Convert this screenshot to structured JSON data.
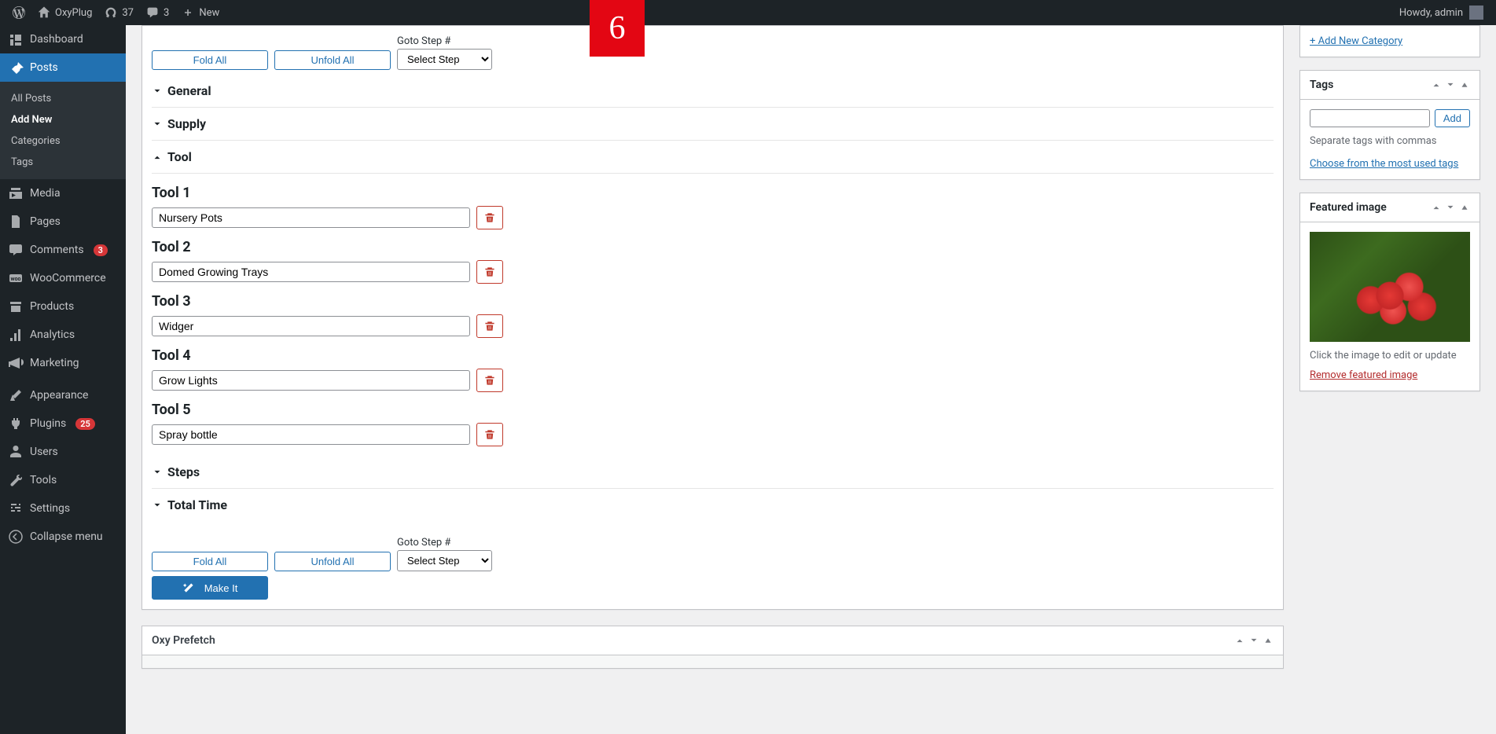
{
  "adminbar": {
    "site_name": "OxyPlug",
    "updates_count": "37",
    "comments_count": "3",
    "new_label": "New",
    "howdy": "Howdy, admin"
  },
  "badge": "6",
  "sidebar": {
    "items": [
      {
        "label": "Dashboard",
        "icon": "dashboard"
      },
      {
        "label": "Posts",
        "icon": "pin",
        "active": true
      },
      {
        "label": "Media",
        "icon": "media"
      },
      {
        "label": "Pages",
        "icon": "pages"
      },
      {
        "label": "Comments",
        "icon": "comments",
        "badge": "3"
      },
      {
        "label": "WooCommerce",
        "icon": "woo"
      },
      {
        "label": "Products",
        "icon": "products"
      },
      {
        "label": "Analytics",
        "icon": "analytics"
      },
      {
        "label": "Marketing",
        "icon": "marketing"
      },
      {
        "label": "Appearance",
        "icon": "appearance"
      },
      {
        "label": "Plugins",
        "icon": "plugins",
        "badge": "25"
      },
      {
        "label": "Users",
        "icon": "users"
      },
      {
        "label": "Tools",
        "icon": "tools"
      },
      {
        "label": "Settings",
        "icon": "settings"
      },
      {
        "label": "Collapse menu",
        "icon": "collapse"
      }
    ],
    "submenu": [
      {
        "label": "All Posts"
      },
      {
        "label": "Add New",
        "current": true
      },
      {
        "label": "Categories"
      },
      {
        "label": "Tags"
      }
    ]
  },
  "controls": {
    "fold": "Fold All",
    "unfold": "Unfold All",
    "goto_label": "Goto Step #",
    "goto_selected": "Select Step",
    "make_it": "Make It"
  },
  "sections": {
    "general": "General",
    "supply": "Supply",
    "tool": "Tool",
    "steps": "Steps",
    "total_time": "Total Time"
  },
  "tools": [
    {
      "label": "Tool 1",
      "value": "Nursery Pots"
    },
    {
      "label": "Tool 2",
      "value": "Domed Growing Trays"
    },
    {
      "label": "Tool 3",
      "value": "Widger"
    },
    {
      "label": "Tool 4",
      "value": "Grow Lights"
    },
    {
      "label": "Tool 5",
      "value": "Spray bottle"
    }
  ],
  "side": {
    "categories": {
      "add_new": "+ Add New Category"
    },
    "tags": {
      "title": "Tags",
      "add_btn": "Add",
      "help": "Separate tags with commas",
      "choose": "Choose from the most used tags"
    },
    "featured": {
      "title": "Featured image",
      "help": "Click the image to edit or update",
      "remove": "Remove featured image"
    }
  },
  "oxy": {
    "title": "Oxy Prefetch"
  }
}
